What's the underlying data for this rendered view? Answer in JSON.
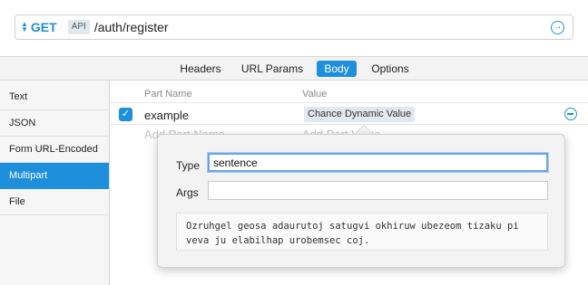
{
  "request": {
    "method": "GET",
    "api_badge": "API",
    "path": "/auth/register"
  },
  "tabs": [
    {
      "label": "Headers",
      "active": false
    },
    {
      "label": "URL Params",
      "active": false
    },
    {
      "label": "Body",
      "active": true
    },
    {
      "label": "Options",
      "active": false
    }
  ],
  "sidebar": {
    "items": [
      {
        "label": "Text",
        "active": false
      },
      {
        "label": "JSON",
        "active": false
      },
      {
        "label": "Form URL-Encoded",
        "active": false
      },
      {
        "label": "Multipart",
        "active": true
      },
      {
        "label": "File",
        "active": false
      }
    ]
  },
  "table": {
    "headers": {
      "part_name": "Part Name",
      "value": "Value"
    },
    "rows": [
      {
        "checked": true,
        "part_name": "example",
        "value": "Chance Dynamic Value"
      }
    ],
    "placeholder_name": "Add Part Name",
    "placeholder_value": "Add Part Value"
  },
  "popover": {
    "type_label": "Type",
    "type_value": "sentence",
    "args_label": "Args",
    "args_value": "",
    "preview": "Ozruhgel geosa adaurutoj satugvi okhiruw ubezeom tizaku pi veva ju elabilhap urobemsec coj."
  },
  "colors": {
    "accent": "#1e8fdb"
  },
  "icons": {
    "method_toggle": "up-down-arrows-icon",
    "send": "circle-arrow-right-icon",
    "remove": "circle-minus-icon",
    "checkbox": "checkmark-icon"
  }
}
